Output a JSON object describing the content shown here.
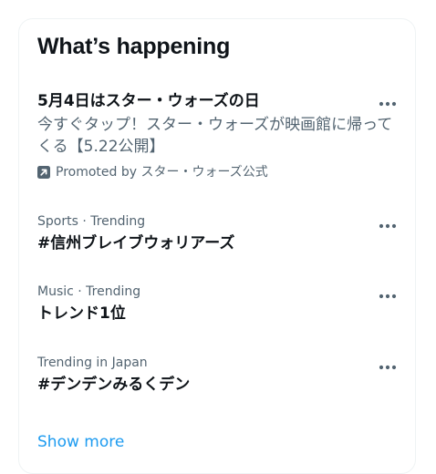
{
  "panel": {
    "title": "What’s happening",
    "show_more": "Show more"
  },
  "promoted": {
    "title": "5月4日はスター・ウォーズの日",
    "description": "今すぐタップ！スター・ウォーズが映画館に帰ってくる【5.22公開】",
    "promoted_by": "Promoted by スター・ウォーズ公式",
    "icon": "promoted-arrow-icon"
  },
  "trends": [
    {
      "meta": "Sports · Trending",
      "name": "#信州ブレイブウォリアーズ"
    },
    {
      "meta": "Music · Trending",
      "name": "トレンド1位"
    },
    {
      "meta": "Trending in Japan",
      "name": "#デンデンみるくデン"
    }
  ],
  "icons": {
    "more": "more-dots-icon"
  },
  "colors": {
    "text_primary": "#0f1419",
    "text_secondary": "#536471",
    "accent": "#1d9bf0",
    "border": "#eff3f4"
  }
}
